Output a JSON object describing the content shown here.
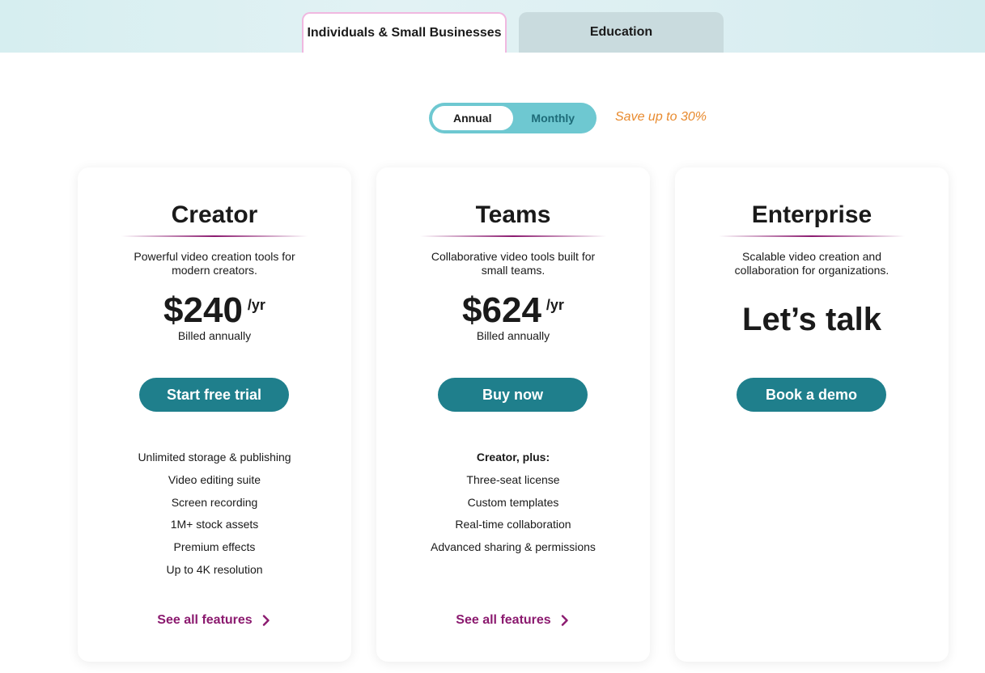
{
  "tabs": {
    "individuals": "Individuals & Small Businesses",
    "education": "Education"
  },
  "billing_toggle": {
    "annual": "Annual",
    "monthly": "Monthly",
    "selected": "Annual",
    "save_note": "Save up to 30%"
  },
  "plans": [
    {
      "title": "Creator",
      "description": "Powerful video creation tools for modern creators.",
      "price": "$240",
      "period": "/yr",
      "billed": "Billed annually",
      "cta": "Start free trial",
      "features": [
        "Unlimited storage & publishing",
        "Video editing suite",
        "Screen recording",
        "1M+ stock assets",
        "Premium effects",
        "Up to 4K resolution"
      ],
      "see_all": "See all features"
    },
    {
      "title": "Teams",
      "description": "Collaborative video tools built for small teams.",
      "price": "$624",
      "period": "/yr",
      "billed": "Billed annually",
      "cta": "Buy now",
      "features_heading": "Creator, plus:",
      "features": [
        "Three-seat license",
        "Custom templates",
        "Real-time collaboration",
        "Advanced sharing & permissions"
      ],
      "see_all": "See all features"
    },
    {
      "title": "Enterprise",
      "description": "Scalable video creation and collaboration for organizations.",
      "price_text": "Let’s talk",
      "cta": "Book a demo"
    }
  ],
  "colors": {
    "accent_teal": "#1f7f8c",
    "toggle_bg": "#6ec8d1",
    "link_purple": "#8b1a6f",
    "save_orange": "#e88a2e"
  }
}
